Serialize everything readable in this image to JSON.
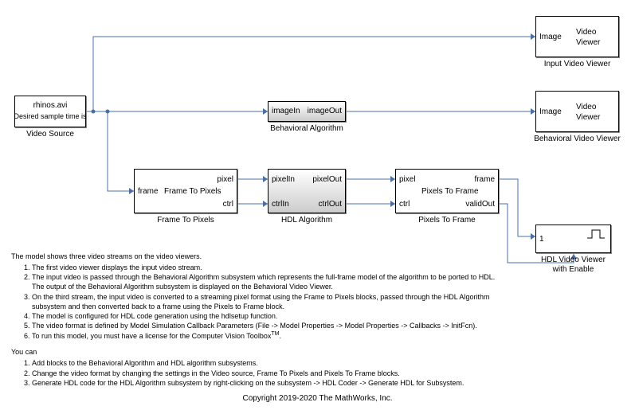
{
  "source": {
    "line1": "rhinos.avi",
    "line2": "Desired sample time is",
    "label": "Video Source"
  },
  "viewer_in": {
    "port": "Image",
    "title1": "Video",
    "title2": "Viewer",
    "label": "Input Video Viewer"
  },
  "beh_alg": {
    "in": "imageIn",
    "out": "imageOut",
    "label": "Behavioral Algorithm"
  },
  "viewer_beh": {
    "port": "Image",
    "title1": "Video",
    "title2": "Viewer",
    "label": "Behavioral Video Viewer"
  },
  "f2p": {
    "in": "frame",
    "title": "Frame To Pixels",
    "out1": "pixel",
    "out2": "ctrl",
    "label": "Frame To Pixels"
  },
  "hdl_alg": {
    "in1": "pixelIn",
    "in2": "ctrlIn",
    "out1": "pixelOut",
    "out2": "ctrlOut",
    "label": "HDL Algorithm"
  },
  "p2f": {
    "in1": "pixel",
    "in2": "ctrl",
    "title": "Pixels To Frame",
    "out1": "frame",
    "out2": "validOut",
    "label": "Pixels To Frame"
  },
  "hdl_view": {
    "port": "1",
    "label1": "HDL Video Viewer",
    "label2": "with Enable"
  },
  "text": {
    "intro": "The model shows three video streams on the video viewers.",
    "m1": "The first video viewer displays the input video stream.",
    "m2": "The input video is passed through the Behavioral Algorithm subsystem which represents the full-frame model of the algorithm to be ported to HDL.",
    "m2b": "The output of the Behavioral Algorithm subsystem is displayed on the Behavioral Video Viewer.",
    "m3": "On the third stream, the input video is converted to a streaming pixel format using the Frame to Pixels blocks, passed through the HDL Algorithm",
    "m3b": "subsystem and then converted back to a frame using the Pixels to Frame block.",
    "m4": "The model is configured for HDL code generation using the hdlsetup function.",
    "m5": "The video format is defined by Model Simulation Callback Parameters (File -> Model Properties -> Model Properties -> Callbacks -> InitFcn).",
    "m6": "To run this model, you must have a license for the Computer Vision Toolbox",
    "tm": "TM",
    "you": "You can",
    "y1": "Add blocks to the Behavioral Algorithm and HDL algorithm subsystems.",
    "y2": "Change the video format by changing the settings in the Video source, Frame To Pixels and Pixels To Frame blocks.",
    "y3": "Generate HDL code for the HDL Algorithm subsystem by right-clicking on the subsystem -> HDL Coder -> Generate HDL for Subsystem.",
    "copy": "Copyright 2019-2020 The MathWorks, Inc."
  }
}
